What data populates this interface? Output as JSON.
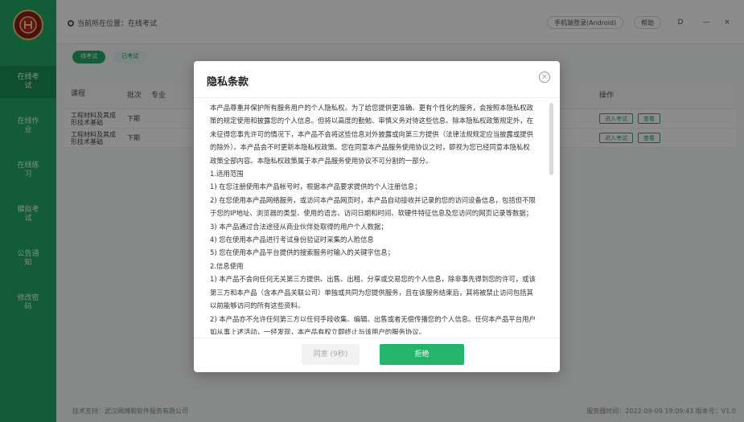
{
  "sidebar": {
    "items": [
      {
        "label": "在线考试"
      },
      {
        "label": "在线作业"
      },
      {
        "label": "在线练习"
      },
      {
        "label": "模拟考试"
      },
      {
        "label": "公告通知"
      },
      {
        "label": "修改密码"
      }
    ]
  },
  "topbar": {
    "breadcrumb": "当前所在位置：在线考试",
    "pill_android": "手机端登录(Android)",
    "pill_help": "帮助",
    "icon_d": "D",
    "icon_min": "—"
  },
  "tabs": [
    {
      "label": "待考试"
    },
    {
      "label": "已考试"
    }
  ],
  "table": {
    "headers": {
      "course": "课程",
      "batch": "批次",
      "major": "专业",
      "ops": "操作"
    },
    "rows": [
      {
        "course": "工程材料及其成形技术基础",
        "batch": "下期",
        "op1": "进入考试",
        "op2": "查看"
      },
      {
        "course": "工程材料及其成形技术基础",
        "batch": "下期",
        "op1": "进入考试",
        "op2": "查看"
      }
    ]
  },
  "footer": {
    "left": "技术支持：武汉网博和软件服务有限公司",
    "right": "服务器时间：2022-09-09 19:09:43 版本号：V1.0"
  },
  "modal": {
    "title": "隐私条款",
    "close": "×",
    "lines": [
      "本产品尊重并保护所有服务用户的个人隐私权。为了给您提供更准确、更有个性化的服务，会按照本隐私权政",
      "策的规定使用和披露您的个人信息。但将以高度的勤勉、审慎义务对待这些信息。除本隐私权政策规定外，在",
      "未征得您事先许可的情况下，本产品不会将这些信息对外披露或向第三方提供（法律法规规定应当披露或提供",
      "的除外）。本产品会不时更新本隐私权政策。您在同意本产品服务使用协议之时，即视为您已经同意本隐私权",
      "政策全部内容。本隐私权政策属于本产品服务使用协议不可分割的一部分。",
      "1.适用范围",
      "1) 在您注册使用本产品帐号时，根据本产品要求提供的个人注册信息；",
      "2) 在您使用本产品网络服务，或访问本产品网页时，本产品自动接收并记录的您的访问设备信息，包括但不限",
      "于您的IP地址、浏览器的类型、使用的语言、访问日期和时间、软硬件特征信息及您访问的网页记录等数据；",
      "3) 本产品通过合法途径从商业伙伴处取得的用户个人数据；",
      "4) 您在使用本产品进行考试身份验证时采集的人脸信息",
      "5) 您在使用本产品平台提供的搜索服务时输入的关键字信息；",
      "2.信息使用",
      "1) 本产品不会向任何无关第三方提供、出售、出租、分享或交易您的个人信息，除非事先得到您的许可，或该",
      "第三方和本产品（含本产品关联公司）单独或共同为您提供服务，且在该服务结束后，其将被禁止访问包括其",
      "以前能够访问的所有这些资料。",
      "2) 本产品亦不允许任何第三方以任何手段收集、编辑、出售或者无偿传播您的个人信息。任何本产品平台用户",
      "如从事上述活动，一经发现，本产品有权立即终止与该用户的服务协议。"
    ],
    "agree_label": "同意 (9秒)",
    "reject_label": "拒绝"
  }
}
